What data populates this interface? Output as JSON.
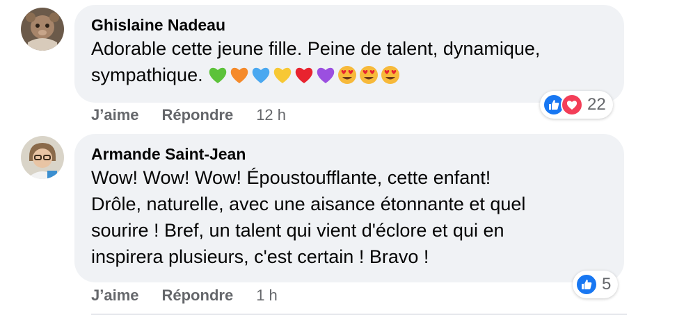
{
  "comments": [
    {
      "author": "Ghislaine Nadeau",
      "text_line1": "Adorable cette jeune fille. Peine de talent, dynamique,",
      "text_line2": "sympathique.",
      "emojis": [
        "green-heart",
        "orange-heart",
        "blue-heart",
        "yellow-heart",
        "red-heart",
        "purple-heart",
        "heart-eyes",
        "heart-eyes",
        "heart-eyes"
      ],
      "like_label": "J’aime",
      "reply_label": "Répondre",
      "time": "12 h",
      "reaction_count": "22",
      "reaction_icons": [
        "like-icon",
        "love-icon"
      ]
    },
    {
      "author": "Armande Saint-Jean",
      "text_lines": [
        "Wow! Wow! Wow! Époustoufflante, cette enfant!",
        "Drôle, naturelle, avec une aisance étonnante et quel",
        "sourire ! Bref, un talent qui vient d'éclore et qui en",
        "inspirera plusieurs, c'est certain ! Bravo !"
      ],
      "like_label": "J’aime",
      "reply_label": "Répondre",
      "time": "1 h",
      "reaction_count": "5",
      "reaction_icons": [
        "like-icon"
      ]
    }
  ],
  "colors": {
    "bubble": "#f0f2f5",
    "meta_text": "#65676b",
    "like_blue": "#1877f2",
    "love_red": "#f33e58"
  }
}
